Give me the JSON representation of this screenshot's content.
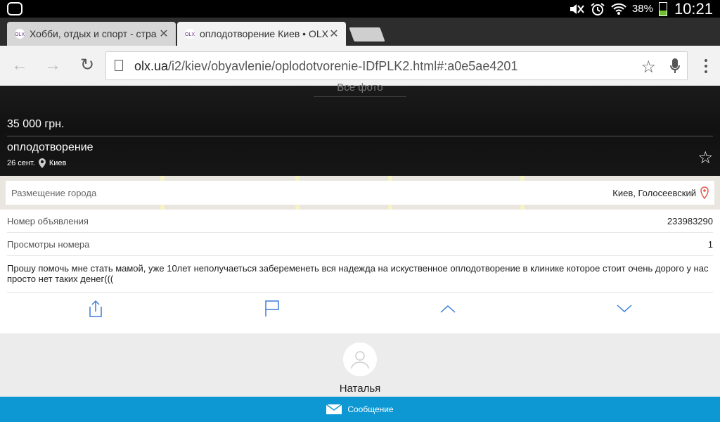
{
  "status_bar": {
    "battery_percent": "38%",
    "battery_level": 0.38,
    "time": "10:21",
    "icons": [
      "app-icon",
      "mute-icon",
      "alarm-icon",
      "wifi-icon",
      "battery-icon"
    ]
  },
  "tabs": [
    {
      "title": "Хобби, отдых и спорт - стра",
      "active": false
    },
    {
      "title": "оплодотворение Киев • OLX",
      "active": true
    }
  ],
  "address_bar": {
    "url_host": "olx.ua",
    "url_path": "/i2/kiev/obyavlenie/oplodotvorenie-IDfPLK2.html#:a0e5ae4201"
  },
  "listing": {
    "photos_link": "Все фото",
    "price": "35 000 грн.",
    "title": "оплодотворение",
    "date": "26 сент.",
    "city": "Киев"
  },
  "location": {
    "label": "Размещение города",
    "value": "Киев, Голосеевский"
  },
  "details": [
    {
      "key": "Номер объявления",
      "value": "233983290"
    },
    {
      "key": "Просмотры номера",
      "value": "1"
    }
  ],
  "description": "Прошу помочь мне стать мамой, уже 10лет неполучаеться забеременеть вся надежда на искуственное оплодотворение в клинике которое стоит очень дорого у нас просто нет таких денег(((",
  "seller": {
    "name": "Наталья"
  },
  "message_button": {
    "label": "Сообщение"
  },
  "colors": {
    "accent": "#0d98d4",
    "icon_blue": "#3b7dd8"
  }
}
